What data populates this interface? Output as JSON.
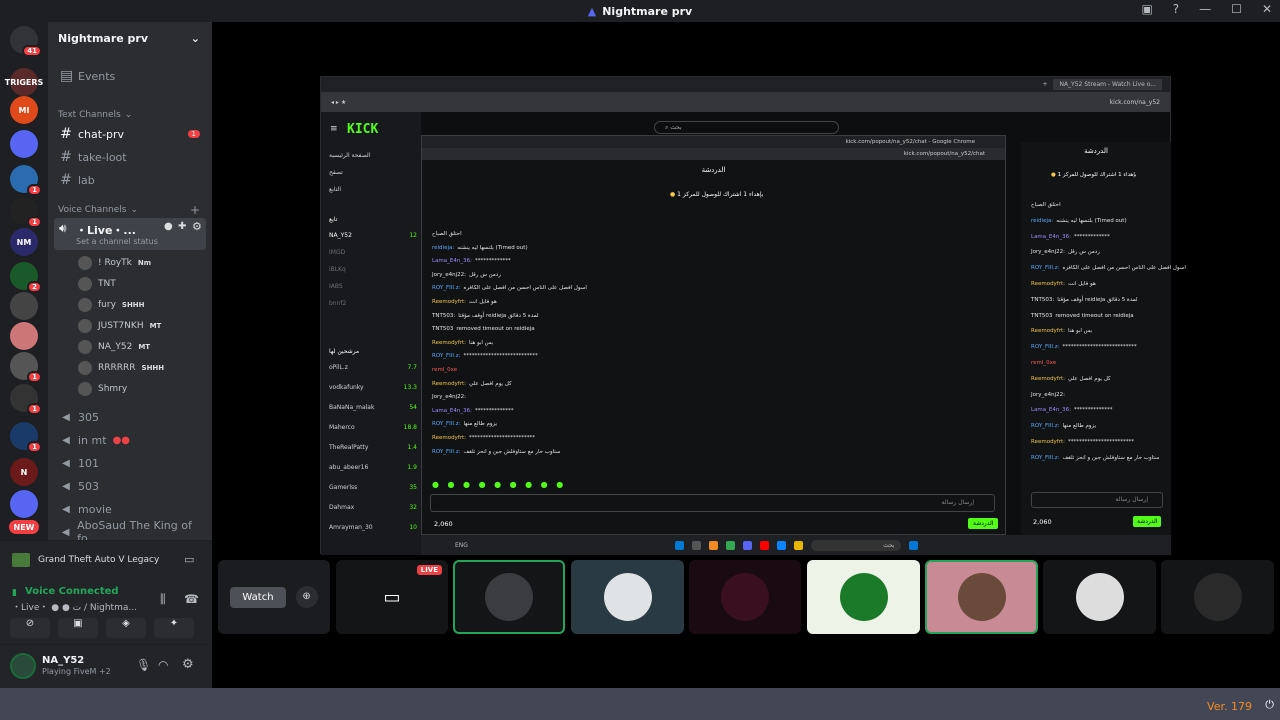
{
  "app": {
    "title": "Nightmare prv",
    "version": "Ver. 179"
  },
  "guilds": [
    {
      "id": "home",
      "label": "",
      "badge": "41",
      "color": "#313338"
    },
    {
      "id": "g1",
      "label": "TRIGERS",
      "badge": "",
      "color": "#5a2a2a"
    },
    {
      "id": "g2",
      "label": "MI",
      "badge": "",
      "color": "#e04a1a"
    },
    {
      "id": "g3",
      "label": "",
      "badge": "",
      "color": "#5865f2"
    },
    {
      "id": "g4",
      "label": "",
      "badge": "1",
      "color": "#2b6cb0"
    },
    {
      "id": "g5",
      "label": "",
      "badge": "1",
      "color": "#222"
    },
    {
      "id": "g6",
      "label": "NM",
      "badge": "",
      "color": "#2a2a6a"
    },
    {
      "id": "g7",
      "label": "",
      "badge": "2",
      "color": "#1a5a2a"
    },
    {
      "id": "g8",
      "label": "",
      "badge": "",
      "color": "#444"
    },
    {
      "id": "g9",
      "label": "",
      "badge": "",
      "color": "#c77"
    },
    {
      "id": "g10",
      "label": "",
      "badge": "1",
      "color": "#555"
    },
    {
      "id": "g11",
      "label": "",
      "badge": "1",
      "color": "#333"
    },
    {
      "id": "g12",
      "label": "",
      "badge": "1",
      "color": "#1a3a6a"
    },
    {
      "id": "g13",
      "label": "N",
      "badge": "",
      "color": "#6a1a1a"
    },
    {
      "id": "g14",
      "label": "",
      "badge": "",
      "color": "#5865f2"
    },
    {
      "id": "new",
      "label": "NEW",
      "badge": "",
      "color": "#f23f43"
    }
  ],
  "sidebar": {
    "server_name": "Nightmare prv",
    "events_label": "Events",
    "text_category": "Text Channels",
    "voice_category": "Voice Channels",
    "text_channels": [
      {
        "name": "chat-prv",
        "badge": "1"
      },
      {
        "name": "take-loot",
        "badge": ""
      },
      {
        "name": "lab",
        "badge": ""
      }
    ],
    "live_channel": {
      "name": "・Live・...",
      "status": "Set a channel status"
    },
    "voice_users": [
      {
        "name": "! RoyTk",
        "tag": "Nm",
        "live": "LIVE"
      },
      {
        "name": "TNT",
        "tag": "",
        "live": "LIVE"
      },
      {
        "name": "fury",
        "tag": "SHHH",
        "live": ""
      },
      {
        "name": "JUST7NKH",
        "tag": "MT",
        "live": ""
      },
      {
        "name": "NA_Y52",
        "tag": "MT",
        "live": ""
      },
      {
        "name": "RRRRRR",
        "tag": "SHHH",
        "live": ""
      },
      {
        "name": "Shmry",
        "tag": "",
        "live": ""
      }
    ],
    "voice_channels": [
      "305",
      "in mt",
      "101",
      "503",
      "movie",
      "AboSaud The King of fo..."
    ]
  },
  "activity": {
    "game": "Grand Theft Auto V Legacy"
  },
  "voice": {
    "status": "Voice Connected",
    "channel": "・Live・ ● ● ت / Nightma..."
  },
  "user": {
    "name": "NA_Y52",
    "activity": "Playing FiveM +2"
  },
  "stream": {
    "browser_tab": "NA_Y52 Stream - Watch Live o...",
    "url": "kick.com/na_y52",
    "popup_title": "kick.com/popout/na_y52/chat - Google Chrome",
    "popup_url": "kick.com/popout/na_y52/chat",
    "chat_title": "الدردشة",
    "pinned": "بإهداء 1 اشتراك للوصول للمركز 1",
    "search_placeholder": "بحث",
    "kick_logo": "KICK",
    "kick_nav": [
      "الصفحة الرئيسية",
      "تصفح",
      "التابع"
    ],
    "following_title": "تابع",
    "recommended_title": "مرشحين لها",
    "following": [
      {
        "name": "NA_Y52",
        "viewers": "12"
      },
      {
        "name": "IMGD",
        "viewers": ""
      },
      {
        "name": "iBLKq",
        "viewers": ""
      },
      {
        "name": "IABS",
        "viewers": ""
      },
      {
        "name": "bnnf2",
        "viewers": ""
      }
    ],
    "recommended": [
      {
        "name": "oPilL.z",
        "viewers": "7.7"
      },
      {
        "name": "vodkafunky",
        "viewers": "13.3"
      },
      {
        "name": "BaNaNa_malak",
        "viewers": "54"
      },
      {
        "name": "Maherco",
        "viewers": "18.8"
      },
      {
        "name": "TheRealPatty",
        "viewers": "1.4"
      },
      {
        "name": "abu_abeer16",
        "viewers": "1.9"
      },
      {
        "name": "Gamerlss",
        "viewers": "35"
      },
      {
        "name": "Dahmax",
        "viewers": "32"
      },
      {
        "name": "Amrayman_30",
        "viewers": "10"
      }
    ],
    "messages": [
      {
        "user": "",
        "text": "احتلق الصباح",
        "color": "#9b8cff"
      },
      {
        "user": "reidieja:",
        "text": "بلتسها ليه ينشنه (Timed out)",
        "color": "#5aa9ff"
      },
      {
        "user": "Lama_E4n_36:",
        "text": "*************",
        "color": "#9b8cff"
      },
      {
        "user": "Jory_e4nj22:",
        "text": "ردمن س رقل",
        "color": "#e6e6e6"
      },
      {
        "user": "ROY_FIII.z:",
        "text": "اسول افصل على الناس احسن من افصل على الكافره",
        "color": "#5aa9ff"
      },
      {
        "user": "Reemodyfrt:",
        "text": "هو فايل انت",
        "color": "#f3c74a"
      },
      {
        "user": "TNT503:",
        "text": "أوقف مؤقتا reidieja لمدة 5 دقائق",
        "color": "#e6e6e6"
      },
      {
        "user": "TNT503",
        "text": "removed timeout on reidieja",
        "color": "#e6e6e6"
      },
      {
        "user": "Reemodyfrt:",
        "text": "بس ابو هنا",
        "color": "#f3c74a"
      },
      {
        "user": "ROY_FIII.z:",
        "text": "***************************",
        "color": "#5aa9ff"
      },
      {
        "user": "reml_0xe",
        "text": "",
        "color": "#ff5a5a"
      },
      {
        "user": "Reemodyfrt:",
        "text": "كل يوم افصل علي",
        "color": "#f3c74a"
      },
      {
        "user": "Jory_e4nj22:",
        "text": "",
        "color": "#e6e6e6"
      },
      {
        "user": "Lama_E4n_36:",
        "text": "**************",
        "color": "#9b8cff"
      },
      {
        "user": "ROY_FIII.z:",
        "text": "يزوم طالع منها",
        "color": "#5aa9ff"
      },
      {
        "user": "Reemodyfrt:",
        "text": "************************",
        "color": "#f3c74a"
      },
      {
        "user": "ROY_FIII.z:",
        "text": "ستاوب حار مع ستاوفلش جبن و انحز تلقف",
        "color": "#5aa9ff"
      }
    ],
    "send_placeholder": "إرسال رسالة",
    "send_button": "الدردشة",
    "points": "2,060",
    "taskbar_search": "بحث",
    "lang": "ENG"
  },
  "tiles": {
    "watch_label": "Watch",
    "live_label": "LIVE"
  }
}
